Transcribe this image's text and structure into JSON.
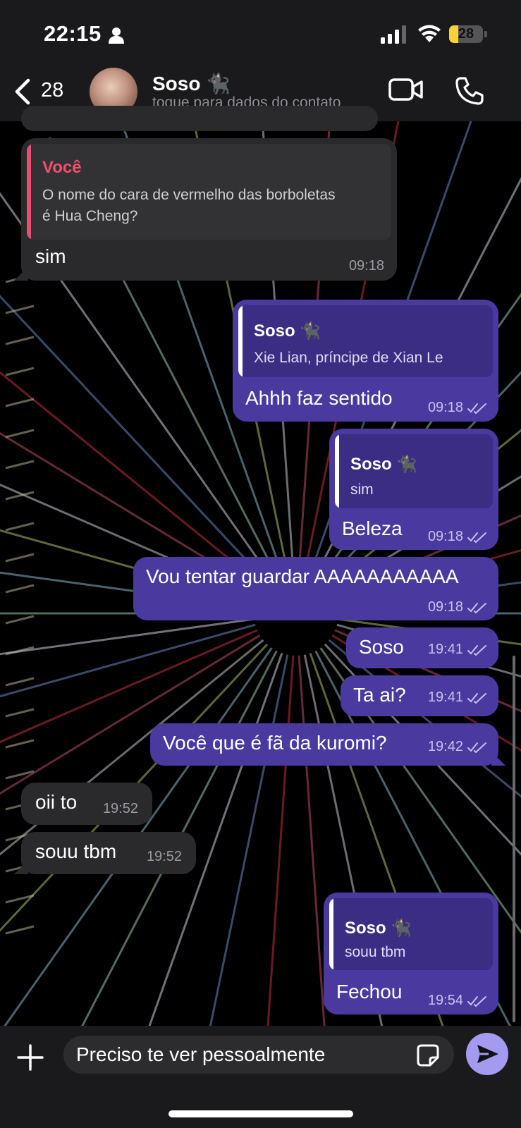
{
  "status_bar": {
    "time": "22:15",
    "battery": "28",
    "battery_level": 0.28
  },
  "header": {
    "back_count": "28",
    "contact_name": "Soso 🐈‍⬛",
    "subtitle": "toque para dados do contato"
  },
  "messages": [
    {
      "id": "m1",
      "direction": "in",
      "quote": {
        "name": "Você",
        "text_lines": [
          "O nome do cara de vermelho das borboletas",
          "é Hua Cheng?"
        ]
      },
      "text": "sim",
      "time": "09:18"
    },
    {
      "id": "m2",
      "direction": "out",
      "quote": {
        "name": "Soso 🐈‍⬛",
        "text": "Xie Lian, príncipe de Xian Le"
      },
      "text": "Ahhh faz sentido",
      "time": "09:18",
      "read": true
    },
    {
      "id": "m3",
      "direction": "out",
      "quote": {
        "name": "Soso 🐈‍⬛",
        "text": "sim"
      },
      "text": "Beleza",
      "time": "09:18",
      "read": true
    },
    {
      "id": "m4",
      "direction": "out",
      "text": "Vou tentar guardar AAAAAAAAAAA",
      "time": "09:18",
      "read": true
    },
    {
      "id": "m5",
      "direction": "out",
      "text": "Soso",
      "time": "19:41",
      "read": true
    },
    {
      "id": "m6",
      "direction": "out",
      "text": "Ta ai?",
      "time": "19:41",
      "read": true
    },
    {
      "id": "m7",
      "direction": "out",
      "text": "Você que é fã da kuromi?",
      "time": "19:42",
      "read": true
    },
    {
      "id": "m8",
      "direction": "in",
      "text": "oii to",
      "time": "19:52"
    },
    {
      "id": "m9",
      "direction": "in",
      "text": "souu tbm",
      "time": "19:52"
    },
    {
      "id": "m10",
      "direction": "out",
      "quote": {
        "name": "Soso 🐈‍⬛",
        "text": "souu tbm"
      },
      "text": "Fechou",
      "time": "19:54",
      "read": true
    }
  ],
  "composer": {
    "value": "Preciso te ver pessoalmente"
  },
  "colors": {
    "outgoing_bubble": "#4a3a9f",
    "incoming_bubble": "#2a2a2c",
    "reply_accent": "#e5506c",
    "send_button": "#a49af0"
  }
}
